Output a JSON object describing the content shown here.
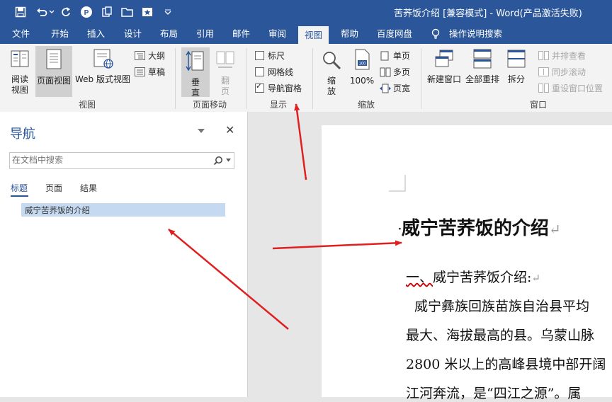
{
  "window": {
    "title": "苦荞饭介绍 [兼容模式]  -  Word(产品激活失败)"
  },
  "quick_access": {
    "items": [
      "save-icon",
      "undo-icon",
      "undo-dropdown-icon",
      "redo-icon",
      "p-icon",
      "clipboard-icon",
      "open-icon",
      "star-icon",
      "customize-icon"
    ]
  },
  "menu": {
    "tabs": [
      "文件",
      "开始",
      "插入",
      "设计",
      "布局",
      "引用",
      "邮件",
      "审阅",
      "视图",
      "帮助",
      "百度网盘"
    ],
    "active": "视图",
    "tell_me": "操作说明搜索"
  },
  "ribbon": {
    "views": {
      "label": "视图",
      "read_mode": "阅读\n视图",
      "print_layout": "页面视图",
      "web_layout": "Web 版式视图",
      "outline": "大纲",
      "draft": "草稿"
    },
    "page_movement": {
      "label": "页面移动",
      "vertical": "垂\n直",
      "side_to_side": "翻\n页"
    },
    "show": {
      "label": "显示",
      "ruler": "标尺",
      "gridlines": "网格线",
      "nav_pane": "导航窗格",
      "ruler_checked": false,
      "gridlines_checked": false,
      "nav_pane_checked": true
    },
    "zoom": {
      "label": "缩放",
      "zoom": "缩\n放",
      "hundred": "100%",
      "one_page": "单页",
      "multi_page": "多页",
      "page_width": "页宽"
    },
    "window": {
      "label": "窗口",
      "new_window": "新建窗口",
      "arrange_all": "全部重排",
      "split": "拆分",
      "side_by_side": "并排查看",
      "sync_scroll": "同步滚动",
      "reset_pos": "重设窗口位置"
    }
  },
  "nav_pane": {
    "title": "导航",
    "search_placeholder": "在文档中搜索",
    "tabs": [
      "标题",
      "页面",
      "结果"
    ],
    "active_tab": "标题",
    "headings": [
      "威宁苦荞饭的介绍"
    ]
  },
  "document": {
    "heading": "威宁苦荞饭的介绍",
    "sub_prefix": "一、",
    "subheading": "威宁苦荞饭介绍:",
    "lines": [
      "威宁彝族回族苗族自治县平均",
      "最大、海拔最高的县。乌蒙山脉",
      "2800 米以上的高峰县境中部开阔",
      "江河奔流，是“四江之源”。属"
    ]
  },
  "colors": {
    "brand": "#2b579a",
    "ribbon_bg": "#f3f3f3",
    "selected_heading": "#c5d9f1",
    "annotation_arrow": "#e02020"
  }
}
